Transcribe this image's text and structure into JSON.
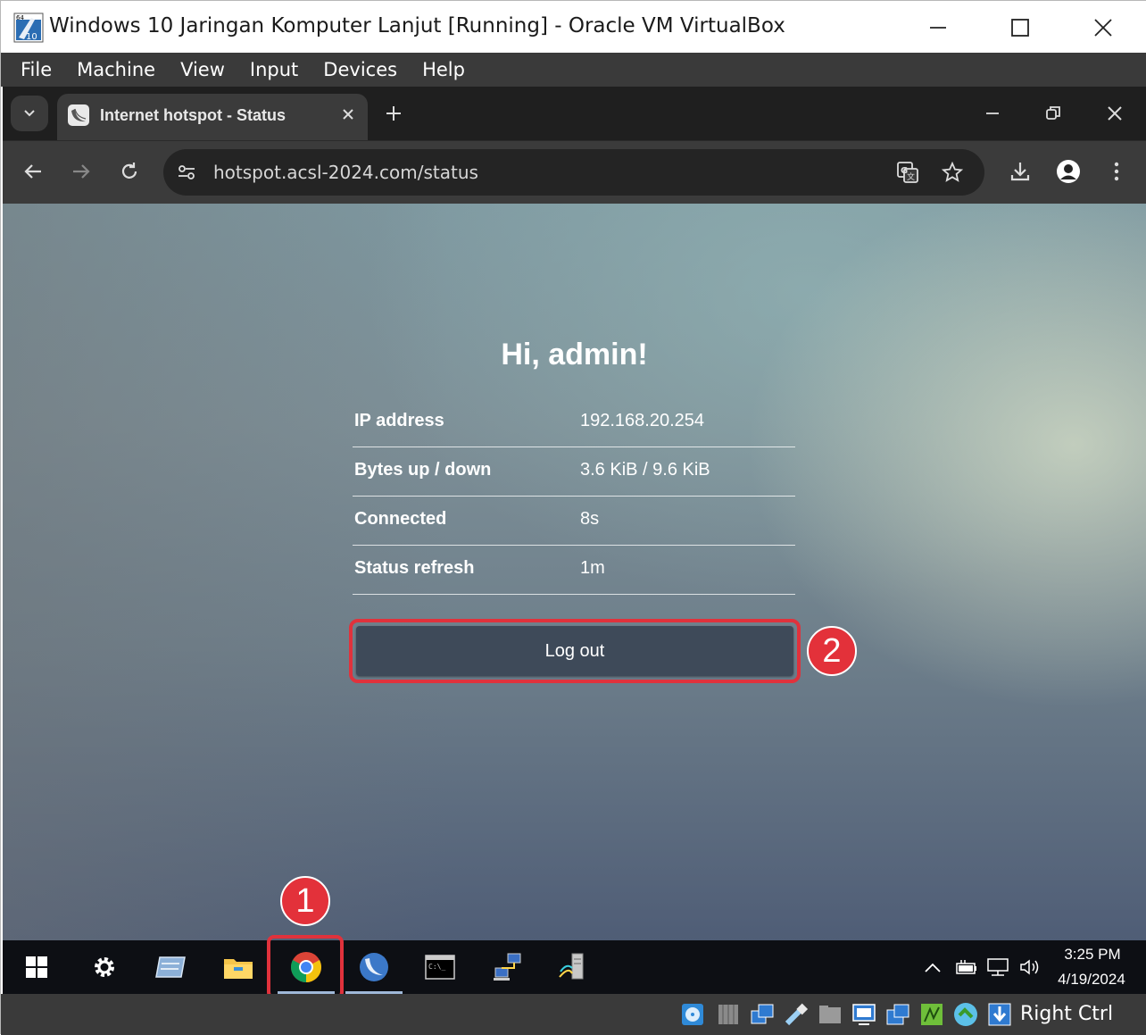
{
  "window": {
    "title": "Windows 10 Jaringan Komputer Lanjut [Running] - Oracle VM VirtualBox",
    "menu": [
      "File",
      "Machine",
      "View",
      "Input",
      "Devices",
      "Help"
    ]
  },
  "browser": {
    "tab_title": "Internet hotspot - Status",
    "url": "hotspot.acsl-2024.com/status"
  },
  "page": {
    "greeting": "Hi, admin!",
    "rows": [
      {
        "label": "IP address",
        "value": "192.168.20.254"
      },
      {
        "label": "Bytes up / down",
        "value": "3.6 KiB / 9.6 KiB"
      },
      {
        "label": "Connected",
        "value": "8s"
      },
      {
        "label": "Status refresh",
        "value": "1m"
      }
    ],
    "logout_label": "Log out"
  },
  "annotations": {
    "step1": "1",
    "step2": "2"
  },
  "taskbar": {
    "time": "3:25 PM",
    "date": "4/19/2024",
    "apps": [
      "start-icon",
      "settings-icon",
      "network-tool-icon",
      "file-explorer-icon",
      "chrome-icon",
      "winbox-icon",
      "command-prompt-icon",
      "network-connections-icon",
      "server-app-icon"
    ]
  },
  "statusbar": {
    "host_key": "Right Ctrl"
  },
  "colors": {
    "accent_red": "#e0323c",
    "button": "#3e4a59",
    "taskbar": "#0d0f14"
  }
}
